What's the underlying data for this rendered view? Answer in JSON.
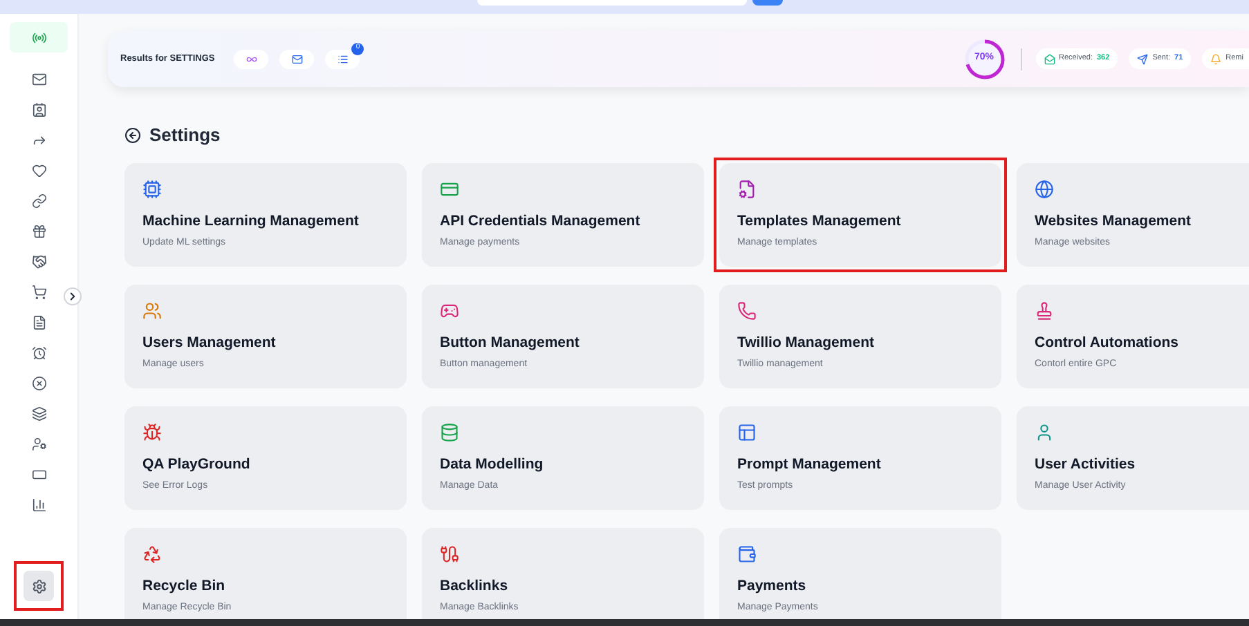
{
  "sidebar": {
    "items": [
      {
        "selected": true
      },
      {
        "selected": false
      },
      {
        "selected": false
      },
      {
        "selected": false
      },
      {
        "selected": false
      },
      {
        "selected": false
      },
      {
        "selected": false
      },
      {
        "selected": false
      },
      {
        "selected": false
      },
      {
        "selected": false
      },
      {
        "selected": false
      },
      {
        "selected": false
      },
      {
        "selected": false
      },
      {
        "selected": false
      },
      {
        "selected": false
      },
      {
        "selected": false
      }
    ],
    "settings_button": {
      "highlighted": true
    }
  },
  "header": {
    "title": "Results for SETTINGS",
    "filters": [
      {
        "kind": "infinity"
      },
      {
        "kind": "mail"
      },
      {
        "kind": "list",
        "badge": "0"
      }
    ],
    "progress": {
      "level": 0.7,
      "reading": "70%"
    },
    "stats": [
      {
        "label": "Received:",
        "value": "362"
      },
      {
        "label": "Sent:",
        "value": "71"
      },
      {
        "label": "Remi"
      }
    ]
  },
  "page_title": "Settings",
  "cards": [
    {
      "title": "Machine Learning Management",
      "subtitle": "Update ML settings",
      "highlighted": false
    },
    {
      "title": "API Credentials Management",
      "subtitle": "Manage payments",
      "highlighted": false
    },
    {
      "title": "Templates Management",
      "subtitle": "Manage templates",
      "highlighted": true
    },
    {
      "title": "Websites Management",
      "subtitle": "Manage websites",
      "highlighted": false
    },
    {
      "title": "Users Management",
      "subtitle": "Manage users",
      "highlighted": false
    },
    {
      "title": "Button Management",
      "subtitle": "Button management",
      "highlighted": false
    },
    {
      "title": "Twillio Management",
      "subtitle": "Twillio management",
      "highlighted": false
    },
    {
      "title": "Control Automations",
      "subtitle": "Contorl entire GPC",
      "highlighted": false
    },
    {
      "title": "QA PlayGround",
      "subtitle": "See Error Logs",
      "highlighted": false
    },
    {
      "title": "Data Modelling",
      "subtitle": "Manage Data",
      "highlighted": false
    },
    {
      "title": "Prompt Management",
      "subtitle": "Test prompts",
      "highlighted": false
    },
    {
      "title": "User Activities",
      "subtitle": "Manage User Activity",
      "highlighted": false
    },
    {
      "title": "Recycle Bin",
      "subtitle": "Manage Recycle Bin",
      "highlighted": false
    },
    {
      "title": "Backlinks",
      "subtitle": "Manage Backlinks",
      "highlighted": false
    },
    {
      "title": "Payments",
      "subtitle": "Manage Payments",
      "highlighted": false
    }
  ]
}
